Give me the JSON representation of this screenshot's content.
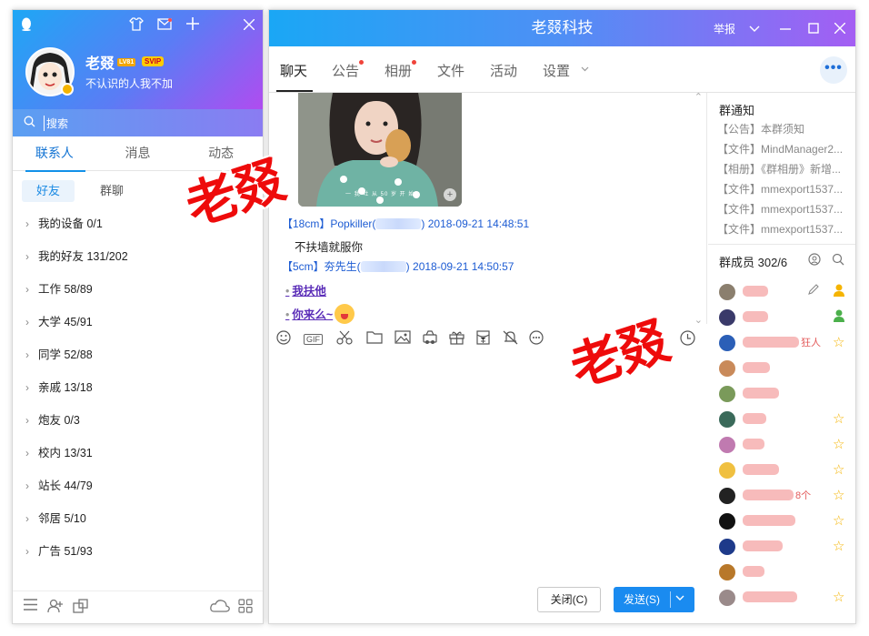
{
  "contacts": {
    "user": {
      "nickname": "老叕",
      "level": "LV81",
      "vip": "SVIP",
      "signature": "不认识的人我不加"
    },
    "search_placeholder": "搜索",
    "tabs": [
      {
        "label": "联系人",
        "active": true
      },
      {
        "label": "消息",
        "active": false
      },
      {
        "label": "动态",
        "active": false
      }
    ],
    "subtabs": [
      {
        "label": "好友",
        "active": true
      },
      {
        "label": "群聊",
        "active": false
      }
    ],
    "groups": [
      "我的设备 0/1",
      "我的好友 131/202",
      "工作 58/89",
      "大学 45/91",
      "同学 52/88",
      "亲戚 13/18",
      "炮友 0/3",
      "校内 13/31",
      "站长 44/79",
      "邻居 5/10",
      "广告 51/93"
    ]
  },
  "chat": {
    "title": "老叕科技",
    "report": "举报",
    "tabs": [
      {
        "label": "聊天",
        "active": true,
        "dot": false
      },
      {
        "label": "公告",
        "active": false,
        "dot": true
      },
      {
        "label": "相册",
        "active": false,
        "dot": true
      },
      {
        "label": "文件",
        "active": false,
        "dot": false
      },
      {
        "label": "活动",
        "active": false,
        "dot": false
      },
      {
        "label": "设置",
        "active": false,
        "dot": false
      }
    ],
    "messages": [
      {
        "tag": "【18cm】",
        "sender": "Popkiller(",
        "close": ")",
        "time": "2018-09-21 14:48:51",
        "text": "不扶墙就服你"
      },
      {
        "tag": "【5cm】",
        "sender": "夯先生(",
        "close": ")",
        "time": "2018-09-21 14:50:57",
        "links": [
          "我扶他",
          "你来么~"
        ]
      }
    ],
    "photo_caption": "一 我 吐 从 50 岁 开 始",
    "buttons": {
      "close": "关闭(C)",
      "send": "发送(S)"
    },
    "watermark": "老叕"
  },
  "group_panel": {
    "notice_title": "群通知",
    "notices": [
      "【公告】本群须知",
      "【文件】MindManager2...",
      "【相册】《群相册》新增...",
      "【文件】mmexport1537...",
      "【文件】mmexport1537...",
      "【文件】mmexport1537..."
    ],
    "members_title": "群成员 302/6",
    "member_fragments": [
      "狂人",
      "8个"
    ]
  },
  "colors": {
    "accent": "#1a8bf0",
    "link": "#1d5cd3",
    "watermark": "#ee0b0b",
    "star": "#f5b400"
  }
}
